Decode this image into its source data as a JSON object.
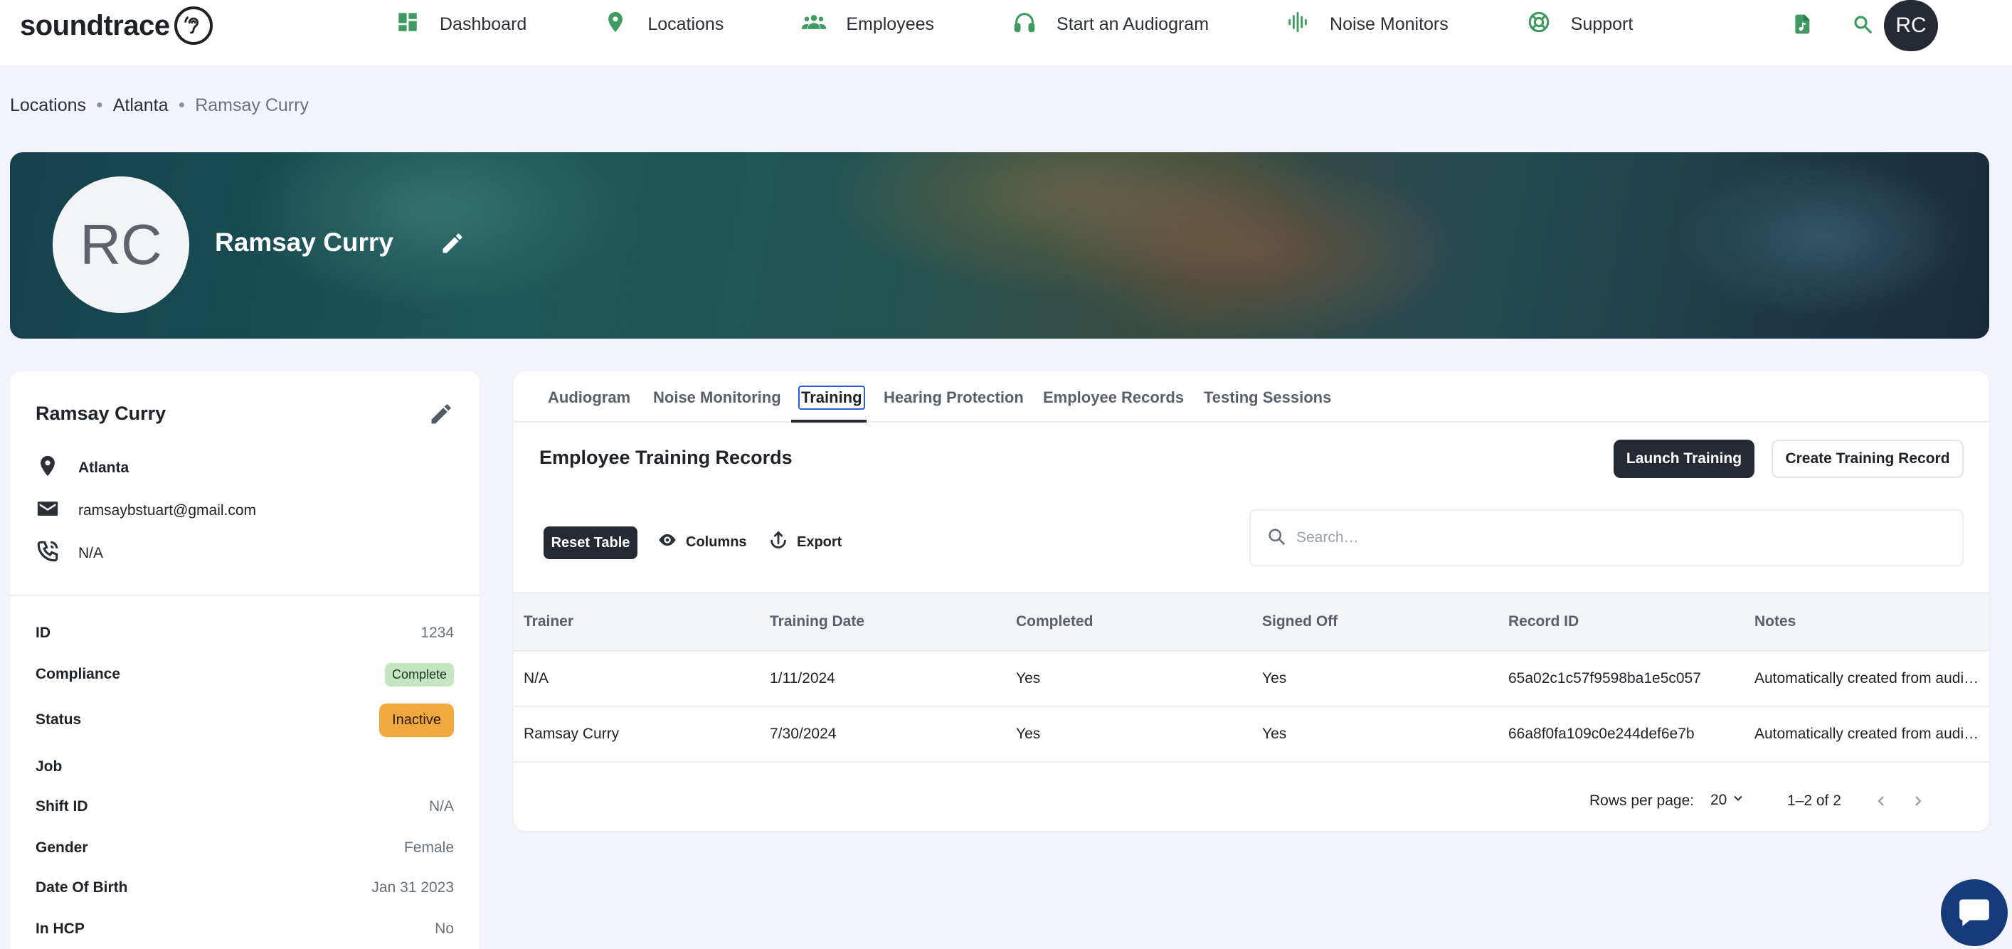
{
  "app": {
    "logo_text": "soundtrace"
  },
  "nav": {
    "items": [
      {
        "label": "Dashboard",
        "icon": "dashboard-icon"
      },
      {
        "label": "Locations",
        "icon": "location-pin-icon"
      },
      {
        "label": "Employees",
        "icon": "people-icon"
      },
      {
        "label": "Start an Audiogram",
        "icon": "headphones-icon"
      },
      {
        "label": "Noise Monitors",
        "icon": "sound-wave-icon"
      },
      {
        "label": "Support",
        "icon": "lifebuoy-icon"
      }
    ],
    "avatar_initials": "RC"
  },
  "breadcrumb": {
    "items": [
      "Locations",
      "Atlanta",
      "Ramsay Curry"
    ]
  },
  "banner": {
    "initials": "RC",
    "name": "Ramsay Curry"
  },
  "profile": {
    "name": "Ramsay Curry",
    "location": "Atlanta",
    "email": "ramsaybstuart@gmail.com",
    "phone": "N/A",
    "fields": [
      {
        "key": "ID",
        "value": "1234"
      },
      {
        "key": "Compliance",
        "value": "Complete"
      },
      {
        "key": "Status",
        "value": "Inactive"
      },
      {
        "key": "Job",
        "value": ""
      },
      {
        "key": "Shift ID",
        "value": "N/A"
      },
      {
        "key": "Gender",
        "value": "Female"
      },
      {
        "key": "Date Of Birth",
        "value": "Jan 31 2023"
      },
      {
        "key": "In HCP",
        "value": "No"
      }
    ]
  },
  "tabs": [
    {
      "label": "Audiogram"
    },
    {
      "label": "Noise Monitoring"
    },
    {
      "label": "Training"
    },
    {
      "label": "Hearing Protection"
    },
    {
      "label": "Employee Records"
    },
    {
      "label": "Testing Sessions"
    }
  ],
  "active_tab": "Training",
  "section": {
    "title": "Employee Training Records",
    "launch_label": "Launch Training",
    "create_label": "Create Training Record"
  },
  "toolbar": {
    "reset_label": "Reset Table",
    "columns_label": "Columns",
    "export_label": "Export",
    "search_placeholder": "Search…"
  },
  "table": {
    "columns": [
      "Trainer",
      "Training Date",
      "Completed",
      "Signed Off",
      "Record ID",
      "Notes"
    ],
    "rows": [
      [
        "N/A",
        "1/11/2024",
        "Yes",
        "Yes",
        "65a02c1c57f9598ba1e5c057",
        "Automatically created from audi…"
      ],
      [
        "Ramsay Curry",
        "7/30/2024",
        "Yes",
        "Yes",
        "66a8f0fa109c0e244def6e7b",
        "Automatically created from audi…"
      ]
    ]
  },
  "pagination": {
    "rows_per_page_label": "Rows per page:",
    "rows_per_page": "20",
    "range": "1–2 of 2"
  },
  "colors": {
    "accent_green": "#3f9a63",
    "dark": "#262a32",
    "badge_complete": "#c6e6c2",
    "badge_inactive": "#f0a93e",
    "chat_blue": "#173a7a"
  }
}
